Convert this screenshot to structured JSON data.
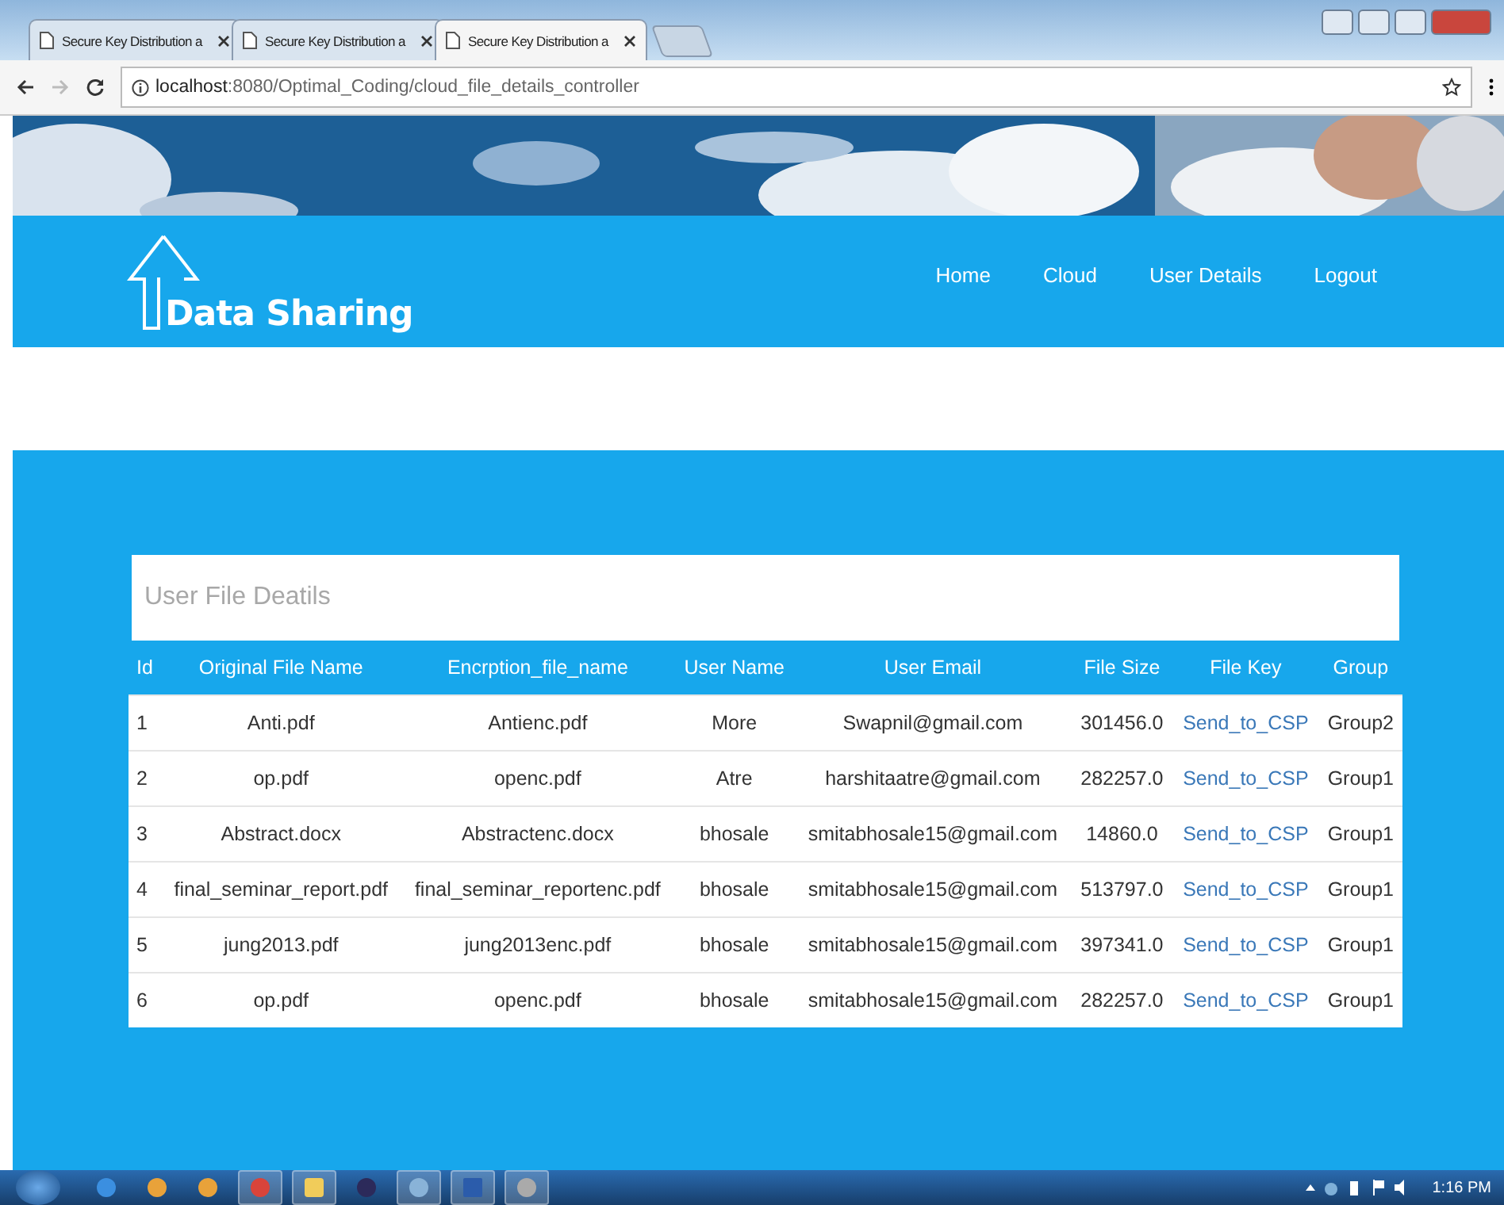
{
  "browser": {
    "tabs": [
      {
        "title": "Secure Key Distribution a",
        "selected": false
      },
      {
        "title": "Secure Key Distribution a",
        "selected": false
      },
      {
        "title": "Secure Key Distribution a",
        "selected": true
      }
    ],
    "address": {
      "host": "localhost",
      "path": ":8080/Optimal_Coding/cloud_file_details_controller"
    }
  },
  "header": {
    "logo": "Data Sharing",
    "nav": [
      "Home",
      "Cloud",
      "User Details",
      "Logout"
    ]
  },
  "table": {
    "title": "User File Deatils",
    "columns": [
      "Id",
      "Original File Name",
      "Encrption_file_name",
      "User Name",
      "User Email",
      "File Size",
      "File Key",
      "Group"
    ],
    "rows": [
      [
        "1",
        "Anti.pdf",
        "Antienc.pdf",
        "More",
        "Swapnil@gmail.com",
        "301456.0",
        "Send_to_CSP",
        "Group2"
      ],
      [
        "2",
        "op.pdf",
        "openc.pdf",
        "Atre",
        "harshitaatre@gmail.com",
        "282257.0",
        "Send_to_CSP",
        "Group1"
      ],
      [
        "3",
        "Abstract.docx",
        "Abstractenc.docx",
        "bhosale",
        "smitabhosale15@gmail.com",
        "14860.0",
        "Send_to_CSP",
        "Group1"
      ],
      [
        "4",
        "final_seminar_report.pdf",
        "final_seminar_reportenc.pdf",
        "bhosale",
        "smitabhosale15@gmail.com",
        "513797.0",
        "Send_to_CSP",
        "Group1"
      ],
      [
        "5",
        "jung2013.pdf",
        "jung2013enc.pdf",
        "bhosale",
        "smitabhosale15@gmail.com",
        "397341.0",
        "Send_to_CSP",
        "Group1"
      ],
      [
        "6",
        "op.pdf",
        "openc.pdf",
        "bhosale",
        "smitabhosale15@gmail.com",
        "282257.0",
        "Send_to_CSP",
        "Group1"
      ]
    ]
  },
  "taskbar": {
    "time": "1:16 PM"
  }
}
